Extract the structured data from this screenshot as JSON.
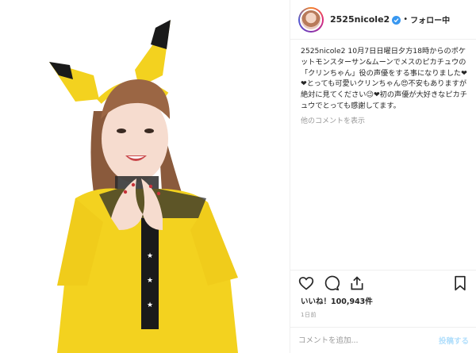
{
  "header": {
    "username": "2525nicole2",
    "separator": "•",
    "follow_label": "フォロー中"
  },
  "caption": {
    "username": "2525nicole2",
    "text": " 10月7日日曜日夕方18時からのポケットモンスターサン&ムーンでメスのピカチュウの「クリンちゃん」役の声優をする事になりました❤❤とっても可愛いクリンちゃん😍不安もありますが絶対に見てください😉❤初の声優が大好きなピカチュウでとっても感謝してます。"
  },
  "more_comments_label": "他のコメントを表示",
  "likes": {
    "prefix": "いいね！",
    "count": "100,943",
    "suffix": "件"
  },
  "time_label": "1日前",
  "comment_bar": {
    "placeholder": "コメントを追加...",
    "post_label": "投稿する"
  },
  "icons": {
    "like": "heart-icon",
    "comment": "comment-icon",
    "share": "share-icon",
    "save": "bookmark-icon",
    "verified": "verified-badge-icon"
  },
  "colors": {
    "accent_blue": "#3897f0",
    "post_disabled": "#b2dffc",
    "costume_yellow": "#f3d21f",
    "ear_black": "#1a1a1a"
  }
}
